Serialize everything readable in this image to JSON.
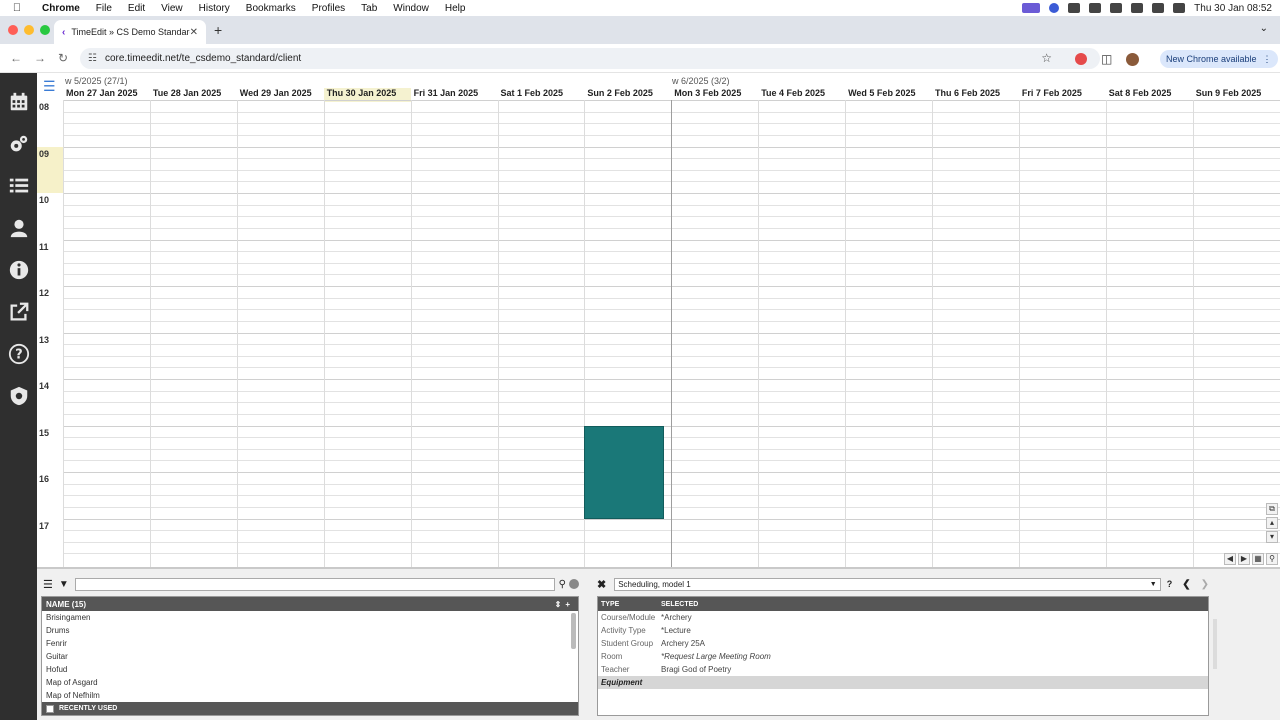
{
  "menubar": {
    "app": "Chrome",
    "items": [
      "File",
      "Edit",
      "View",
      "History",
      "Bookmarks",
      "Profiles",
      "Tab",
      "Window",
      "Help"
    ],
    "datetime": "Thu 30 Jan  08:52"
  },
  "browser": {
    "tab_title": "TimeEdit » CS Demo Standard",
    "url": "core.timeedit.net/te_csdemo_standard/client",
    "update_label": "New Chrome available"
  },
  "calendar": {
    "weeks": [
      "w 5/2025 (27/1)",
      "w 6/2025 (3/2)"
    ],
    "days": [
      {
        "label": "Mon 27 Jan 2025",
        "today": false
      },
      {
        "label": "Tue 28 Jan 2025",
        "today": false
      },
      {
        "label": "Wed 29 Jan 2025",
        "today": false
      },
      {
        "label": "Thu 30 Jan 2025",
        "today": true
      },
      {
        "label": "Fri 31 Jan 2025",
        "today": false
      },
      {
        "label": "Sat 1 Feb 2025",
        "today": false
      },
      {
        "label": "Sun 2 Feb 2025",
        "today": false
      },
      {
        "label": "Mon 3 Feb 2025",
        "today": false
      },
      {
        "label": "Tue 4 Feb 2025",
        "today": false
      },
      {
        "label": "Wed 5 Feb 2025",
        "today": false
      },
      {
        "label": "Thu 6 Feb 2025",
        "today": false
      },
      {
        "label": "Fri 7 Feb 2025",
        "today": false
      },
      {
        "label": "Sat 8 Feb 2025",
        "today": false
      },
      {
        "label": "Sun 9 Feb 2025",
        "today": false
      }
    ],
    "hours": [
      "08",
      "09",
      "10",
      "11",
      "12",
      "13",
      "14",
      "15",
      "16",
      "17"
    ],
    "current_hour": "09",
    "event": {
      "day": "Sun 2 Feb 2025",
      "start": "15:00",
      "end": "17:00",
      "color": "#1a7878"
    }
  },
  "objects": {
    "header": "NAME (15)",
    "items": [
      "Brisingamen",
      "Drums",
      "Fenrir",
      "Guitar",
      "Hofud",
      "Map of Asgard",
      "Map of Nefhilm"
    ],
    "footer": "RECENTLY USED"
  },
  "reservation": {
    "model": "Scheduling, model 1",
    "columns": [
      "TYPE",
      "SELECTED"
    ],
    "rows": [
      {
        "type": "Course/Module",
        "value": "*Archery",
        "italic": false
      },
      {
        "type": "Activity Type",
        "value": "*Lecture",
        "italic": false
      },
      {
        "type": "Student Group",
        "value": "Archery 25A",
        "italic": false
      },
      {
        "type": "Room",
        "value": "*Request Large Meeting Room",
        "italic": true
      },
      {
        "type": "Teacher",
        "value": "Bragi God of Poetry",
        "italic": false
      }
    ],
    "section": "Equipment"
  }
}
